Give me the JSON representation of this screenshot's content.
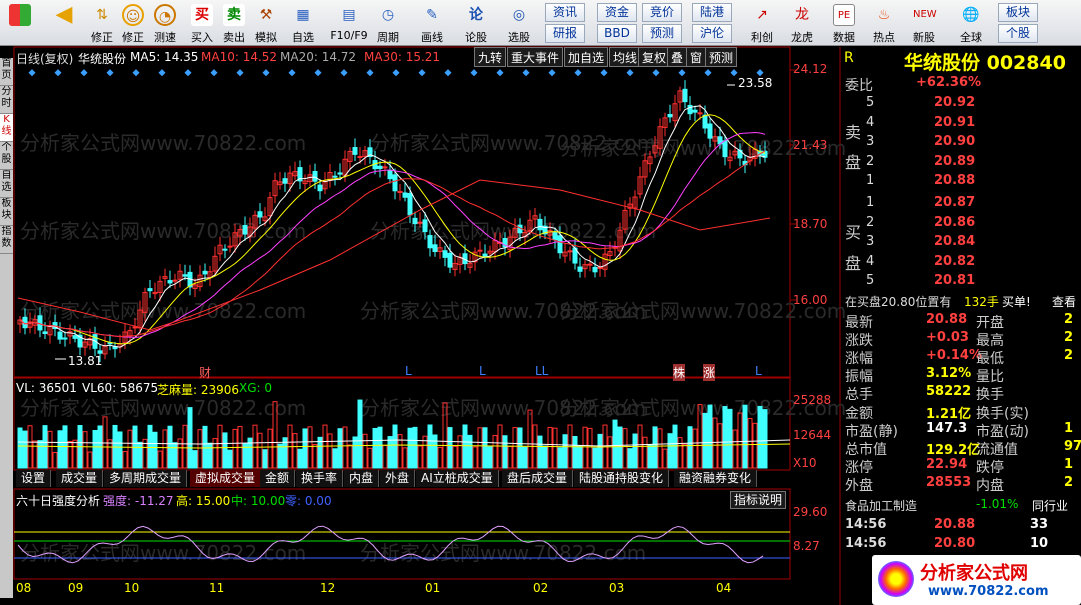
{
  "toolbar": {
    "buttons": [
      "",
      "",
      "修正",
      "测速",
      "买入",
      "卖出",
      "模拟",
      "自选",
      "F10/F9",
      "周期",
      "画线",
      "论股",
      "选股",
      "",
      "",
      "",
      "",
      "利创",
      "龙虎",
      "数据",
      "热点",
      "新股",
      "全球"
    ],
    "links": [
      [
        "资讯",
        "资金",
        "竞价",
        "陆港",
        "板块"
      ],
      [
        "研报",
        "BBD",
        "预测",
        "沪伦",
        "个股"
      ]
    ]
  },
  "chart": {
    "header": "日线(复权)",
    "name": "华统股份",
    "ma5": "MA5: 14.35",
    "ma10": "MA10: 14.52",
    "ma20": "MA20: 14.72",
    "ma30": "MA30: 15.21",
    "buttons": [
      "九转",
      "重大事件",
      "加自选",
      "均线",
      "复权",
      "叠",
      "窗",
      "预测"
    ],
    "yticks": [
      "24.12",
      "21.43",
      "18.70",
      "16.00"
    ],
    "high_label": "23.58",
    "low_label": "13.81",
    "markers": [
      "财",
      "L",
      "L",
      "LL",
      "株",
      "涨",
      "L"
    ]
  },
  "volume": {
    "vl": "VL: 36501",
    "vl60": "VL60: 58675",
    "zm": "芝麻量: 23906",
    "xg": "XG: 0",
    "ticks": [
      "25288",
      "12644",
      "X10"
    ]
  },
  "tabs": [
    "设置",
    "成交量",
    "多周期成交量",
    "虚拟成交量",
    "金额",
    "换手率",
    "内盘",
    "外盘",
    "AI立桩成交量",
    "盘后成交量",
    "陆股通持股变化",
    "融资融券变化"
  ],
  "indicator": {
    "title": "六十日强度分析",
    "strength": "强度: -11.27",
    "high": "高: 15.00",
    "mid": "中: 10.00",
    "low": "零: 0.00",
    "explain": "指标说明",
    "ticks": [
      "29.60",
      "8.27"
    ]
  },
  "months": [
    "08",
    "09",
    "10",
    "11",
    "12",
    "01",
    "02",
    "03",
    "04"
  ],
  "side_tabs": [
    "首页",
    "分时",
    "K线",
    "个股",
    "自选",
    "板块",
    "指数"
  ],
  "quote": {
    "title": "华统股份 002840",
    "r": "R",
    "weibi_k": "委比",
    "weibi_v": "+62.36%",
    "sell": [
      [
        "5",
        "20.92"
      ],
      [
        "4",
        "20.91"
      ],
      [
        "3",
        "20.90"
      ],
      [
        "2",
        "20.89"
      ],
      [
        "1",
        "20.88"
      ]
    ],
    "buy": [
      [
        "1",
        "20.87"
      ],
      [
        "2",
        "20.86"
      ],
      [
        "3",
        "20.84"
      ],
      [
        "4",
        "20.82"
      ],
      [
        "5",
        "20.81"
      ]
    ],
    "sell_label": [
      "卖",
      "盘"
    ],
    "buy_label": [
      "买",
      "盘"
    ],
    "notice": "在买盘20.80位置有",
    "notice_qty": "132手",
    "notice_tag": "买单!",
    "notice_more": "查看",
    "stats_left": [
      [
        "最新",
        "20.88",
        "red"
      ],
      [
        "涨跌",
        "+0.03",
        "red"
      ],
      [
        "涨幅",
        "+0.14%",
        "red"
      ],
      [
        "振幅",
        "3.12%",
        "yel"
      ],
      [
        "总手",
        "58222",
        "yel"
      ],
      [
        "金额",
        "1.21亿",
        "yel"
      ],
      [
        "市盈(静)",
        "147.3",
        "wht"
      ],
      [
        "总市值",
        "129.2亿",
        "yel"
      ],
      [
        "涨停",
        "22.94",
        "red"
      ],
      [
        "外盘",
        "28553",
        "red"
      ]
    ],
    "stats_right": [
      [
        "开盘",
        "2"
      ],
      [
        "最高",
        "2"
      ],
      [
        "最低",
        "2"
      ],
      [
        "量比",
        ""
      ],
      [
        "换手",
        ""
      ],
      [
        "换手(实)",
        ""
      ],
      [
        "市盈(动)",
        "1"
      ],
      [
        "流通值",
        "97."
      ],
      [
        "跌停",
        "1"
      ],
      [
        "内盘",
        "2"
      ]
    ],
    "sector": "食品加工制造",
    "sector_chg": "-1.01%",
    "sector_link": "同行业",
    "ticks": [
      [
        "14:56",
        "20.88",
        "33"
      ],
      [
        "14:56",
        "20.80",
        "10"
      ]
    ]
  },
  "watermark": "分析家公式网",
  "watermark_url": "www.70822.com"
}
